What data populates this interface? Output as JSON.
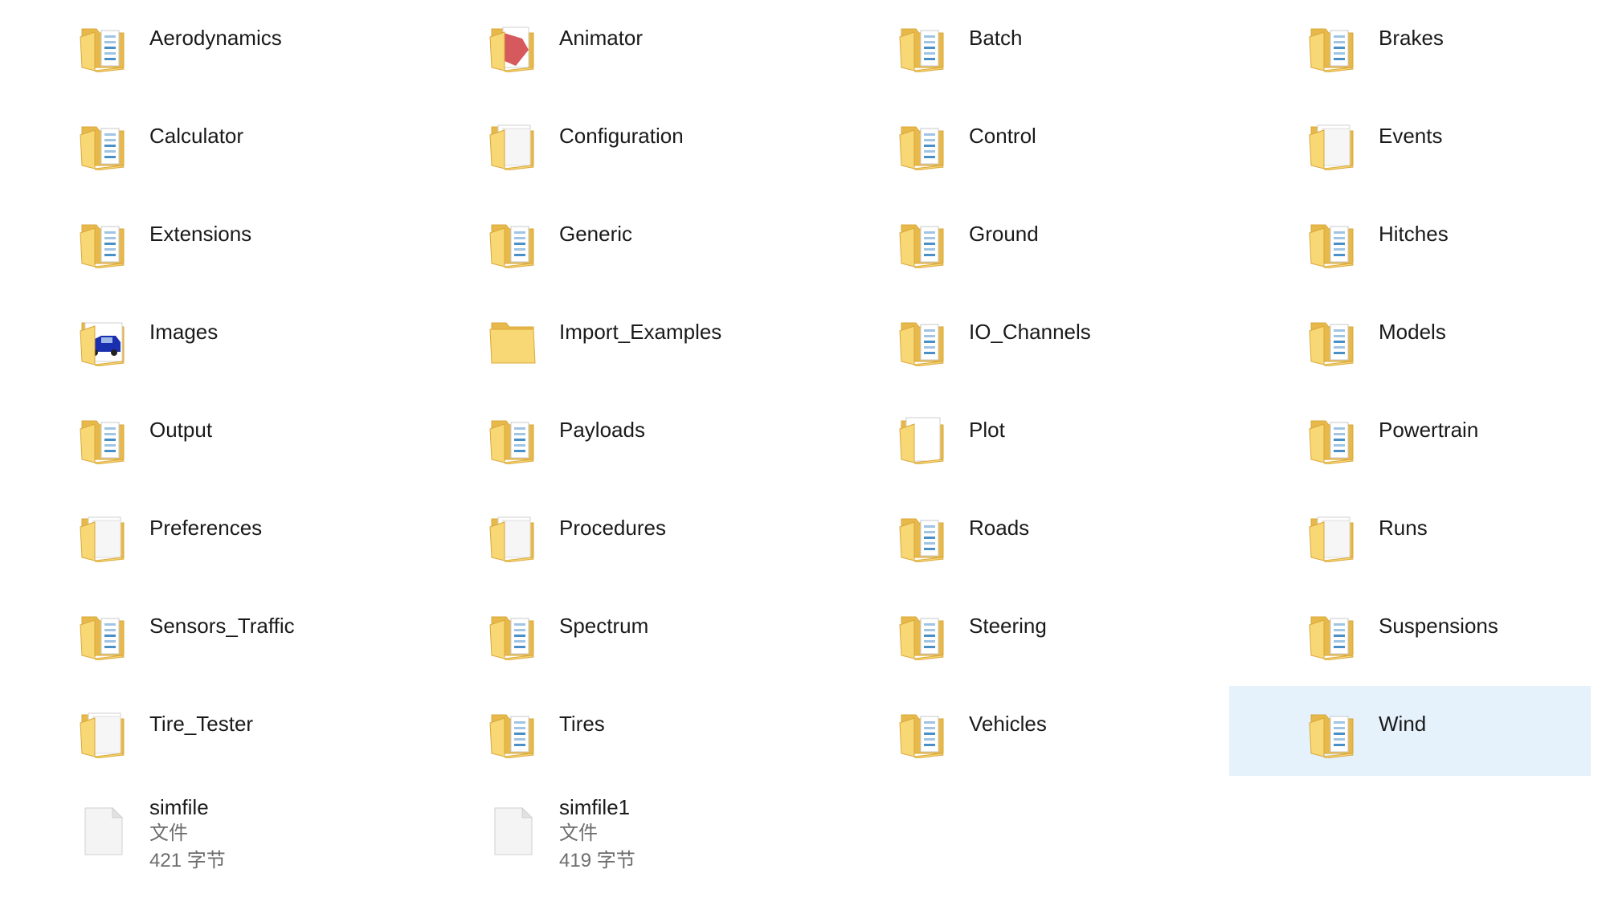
{
  "colors": {
    "folder_body": "#f8d775",
    "folder_back": "#e7b94a",
    "folder_edge": "#d9a83a",
    "selected_bg": "#e5f1fb",
    "page": "#ffffff"
  },
  "columns": 4,
  "items": [
    {
      "name": "Aerodynamics",
      "kind": "folder",
      "icon": "folder-doc-icon"
    },
    {
      "name": "Animator",
      "kind": "folder",
      "icon": "folder-animator-icon"
    },
    {
      "name": "Batch",
      "kind": "folder",
      "icon": "folder-doc-icon"
    },
    {
      "name": "Brakes",
      "kind": "folder",
      "icon": "folder-doc-icon"
    },
    {
      "name": "Calculator",
      "kind": "folder",
      "icon": "folder-doc-icon"
    },
    {
      "name": "Configuration",
      "kind": "folder",
      "icon": "folder-paper-icon"
    },
    {
      "name": "Control",
      "kind": "folder",
      "icon": "folder-doc-icon"
    },
    {
      "name": "Events",
      "kind": "folder",
      "icon": "folder-paper-icon"
    },
    {
      "name": "Extensions",
      "kind": "folder",
      "icon": "folder-doc-icon"
    },
    {
      "name": "Generic",
      "kind": "folder",
      "icon": "folder-doc-icon"
    },
    {
      "name": "Ground",
      "kind": "folder",
      "icon": "folder-doc-icon"
    },
    {
      "name": "Hitches",
      "kind": "folder",
      "icon": "folder-doc-icon"
    },
    {
      "name": "Images",
      "kind": "folder",
      "icon": "folder-car-icon"
    },
    {
      "name": "Import_Examples",
      "kind": "folder",
      "icon": "folder-empty-icon"
    },
    {
      "name": "IO_Channels",
      "kind": "folder",
      "icon": "folder-doc-icon"
    },
    {
      "name": "Models",
      "kind": "folder",
      "icon": "folder-doc-icon"
    },
    {
      "name": "Output",
      "kind": "folder",
      "icon": "folder-doc-icon"
    },
    {
      "name": "Payloads",
      "kind": "folder",
      "icon": "folder-doc-icon"
    },
    {
      "name": "Plot",
      "kind": "folder",
      "icon": "folder-blank-page-icon"
    },
    {
      "name": "Powertrain",
      "kind": "folder",
      "icon": "folder-doc-icon"
    },
    {
      "name": "Preferences",
      "kind": "folder",
      "icon": "folder-paper-icon"
    },
    {
      "name": "Procedures",
      "kind": "folder",
      "icon": "folder-paper-icon"
    },
    {
      "name": "Roads",
      "kind": "folder",
      "icon": "folder-doc-icon"
    },
    {
      "name": "Runs",
      "kind": "folder",
      "icon": "folder-paper-icon"
    },
    {
      "name": "Sensors_Traffic",
      "kind": "folder",
      "icon": "folder-doc-icon"
    },
    {
      "name": "Spectrum",
      "kind": "folder",
      "icon": "folder-doc-icon"
    },
    {
      "name": "Steering",
      "kind": "folder",
      "icon": "folder-doc-icon"
    },
    {
      "name": "Suspensions",
      "kind": "folder",
      "icon": "folder-doc-icon"
    },
    {
      "name": "Tire_Tester",
      "kind": "folder",
      "icon": "folder-paper-icon"
    },
    {
      "name": "Tires",
      "kind": "folder",
      "icon": "folder-doc-icon"
    },
    {
      "name": "Vehicles",
      "kind": "folder",
      "icon": "folder-doc-icon"
    },
    {
      "name": "Wind",
      "kind": "folder",
      "icon": "folder-doc-icon",
      "selected": true
    },
    {
      "name": "simfile",
      "kind": "file",
      "icon": "generic-file-icon",
      "type": "文件",
      "size": "421 字节"
    },
    {
      "name": "simfile1",
      "kind": "file",
      "icon": "generic-file-icon",
      "type": "文件",
      "size": "419 字节"
    }
  ]
}
